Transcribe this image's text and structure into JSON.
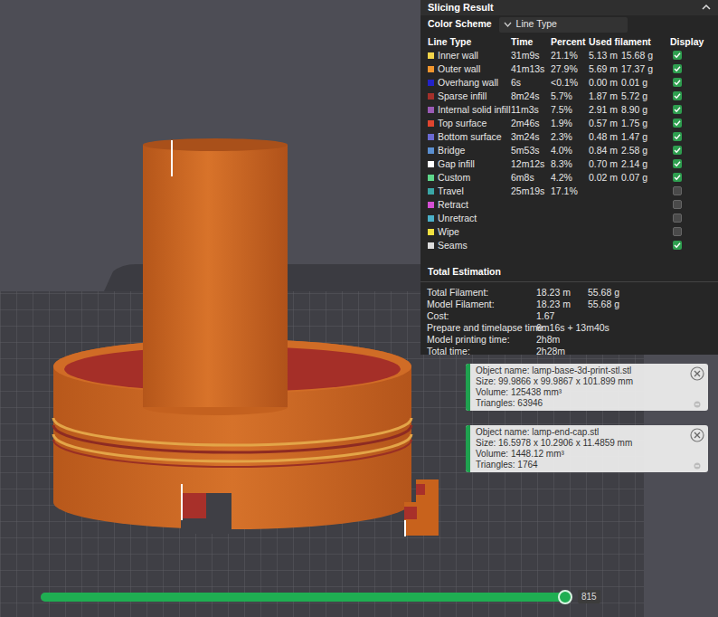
{
  "panel": {
    "title": "Slicing Result",
    "color_scheme_label": "Color Scheme",
    "color_scheme_value": "Line Type",
    "columns": [
      "Line Type",
      "Time",
      "Percent",
      "Used filament",
      "Display"
    ],
    "rows": [
      {
        "name": "Inner wall",
        "time": "31m9s",
        "percent": "21.1%",
        "length": "5.13 m",
        "weight": "15.68 g",
        "color": "#f2d54a",
        "display": true
      },
      {
        "name": "Outer wall",
        "time": "41m13s",
        "percent": "27.9%",
        "length": "5.69 m",
        "weight": "17.37 g",
        "color": "#f0962e",
        "display": true
      },
      {
        "name": "Overhang wall",
        "time": "6s",
        "percent": "<0.1%",
        "length": "0.00 m",
        "weight": "0.01 g",
        "color": "#2323c8",
        "display": true
      },
      {
        "name": "Sparse infill",
        "time": "8m24s",
        "percent": "5.7%",
        "length": "1.87 m",
        "weight": "5.72 g",
        "color": "#a3302b",
        "display": true
      },
      {
        "name": "Internal solid infill",
        "time": "11m3s",
        "percent": "7.5%",
        "length": "2.91 m",
        "weight": "8.90 g",
        "color": "#9a5bb5",
        "display": true
      },
      {
        "name": "Top surface",
        "time": "2m46s",
        "percent": "1.9%",
        "length": "0.57 m",
        "weight": "1.75 g",
        "color": "#e0452f",
        "display": true
      },
      {
        "name": "Bottom surface",
        "time": "3m24s",
        "percent": "2.3%",
        "length": "0.48 m",
        "weight": "1.47 g",
        "color": "#6a6ad2",
        "display": true
      },
      {
        "name": "Bridge",
        "time": "5m53s",
        "percent": "4.0%",
        "length": "0.84 m",
        "weight": "2.58 g",
        "color": "#5a8fd0",
        "display": true
      },
      {
        "name": "Gap infill",
        "time": "12m12s",
        "percent": "8.3%",
        "length": "0.70 m",
        "weight": "2.14 g",
        "color": "#ffffff",
        "display": true
      },
      {
        "name": "Custom",
        "time": "6m8s",
        "percent": "4.2%",
        "length": "0.02 m",
        "weight": "0.07 g",
        "color": "#5ed68a",
        "display": true
      },
      {
        "name": "Travel",
        "time": "25m19s",
        "percent": "17.1%",
        "color": "#3aa6a6",
        "display": false
      },
      {
        "name": "Retract",
        "color": "#d44fd4",
        "display": false
      },
      {
        "name": "Unretract",
        "color": "#4ab0c8",
        "display": false
      },
      {
        "name": "Wipe",
        "color": "#f0e040",
        "display": false
      },
      {
        "name": "Seams",
        "color": "#dddddd",
        "display": true
      }
    ],
    "total_title": "Total Estimation",
    "totals": [
      {
        "label": "Total Filament:",
        "values": [
          "18.23 m",
          "55.68 g"
        ]
      },
      {
        "label": "Model Filament:",
        "values": [
          "18.23 m",
          "55.68 g"
        ]
      },
      {
        "label": "Cost:",
        "values": [
          "1.67"
        ]
      },
      {
        "label": "Prepare and timelapse time:",
        "values": [
          "6m16s + 13m40s"
        ]
      },
      {
        "label": "Model printing time:",
        "values": [
          "2h8m"
        ]
      },
      {
        "label": "Total time:",
        "values": [
          "2h28m"
        ]
      }
    ]
  },
  "objects": [
    {
      "lines": [
        "Object name: lamp-base-3d-print-stl.stl",
        "Size: 99.9866 x 99.9867 x 101.899 mm",
        "Volume: 125438 mm³",
        "Triangles: 63946"
      ]
    },
    {
      "lines": [
        "Object name: lamp-end-cap.stl",
        "Size: 16.5978 x 10.2906 x 11.4859 mm",
        "Volume: 1448.12 mm³",
        "Triangles: 1764"
      ]
    }
  ],
  "layer_slider": {
    "level": 1,
    "reading": "815"
  }
}
